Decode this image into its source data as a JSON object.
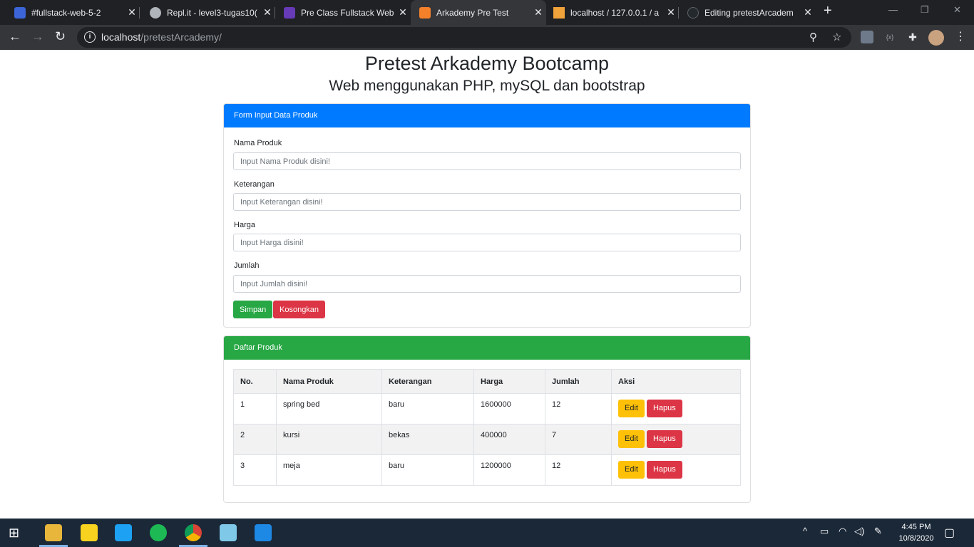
{
  "browser": {
    "tabs": [
      {
        "title": "#fullstack-web-5-2",
        "fav_color": "#3c65d8"
      },
      {
        "title": "Repl.it - level3-tugas10(",
        "fav_color": "#b0b4bb"
      },
      {
        "title": "Pre Class Fullstack Web",
        "fav_color": "#673ab7"
      },
      {
        "title": "Arkademy Pre Test",
        "fav_color": "#f4802a"
      },
      {
        "title": "localhost / 127.0.0.1 / a",
        "fav_color": "#f0a33b"
      },
      {
        "title": "Editing pretestArcadem",
        "fav_color": "#24292e"
      }
    ],
    "url_host": "localhost",
    "url_path": "/pretestArcademy/"
  },
  "page": {
    "title": "Pretest Arkademy Bootcamp",
    "subtitle": "Web menggunakan PHP, mySQL dan bootstrap"
  },
  "form": {
    "header": "Form Input Data Produk",
    "header_color": "#007bff",
    "fields": [
      {
        "label": "Nama Produk",
        "placeholder": "Input Nama Produk disini!"
      },
      {
        "label": "Keterangan",
        "placeholder": "Input Keterangan disini!"
      },
      {
        "label": "Harga",
        "placeholder": "Input Harga disini!"
      },
      {
        "label": "Jumlah",
        "placeholder": "Input Jumlah disini!"
      }
    ],
    "save_label": "Simpan",
    "clear_label": "Kosongkan",
    "save_color": "#28a745",
    "clear_color": "#dc3545"
  },
  "list": {
    "header": "Daftar Produk",
    "header_color": "#28a745",
    "columns": [
      "No.",
      "Nama Produk",
      "Keterangan",
      "Harga",
      "Jumlah",
      "Aksi"
    ],
    "rows": [
      {
        "no": "1",
        "nama": "spring bed",
        "keterangan": "baru",
        "harga": "1600000",
        "jumlah": "12"
      },
      {
        "no": "2",
        "nama": "kursi",
        "keterangan": "bekas",
        "harga": "400000",
        "jumlah": "7"
      },
      {
        "no": "3",
        "nama": "meja",
        "keterangan": "baru",
        "harga": "1200000",
        "jumlah": "12"
      }
    ],
    "edit_label": "Edit",
    "delete_label": "Hapus",
    "edit_color": "#ffc107",
    "delete_color": "#dc3545"
  },
  "taskbar": {
    "time": "4:45 PM",
    "date": "10/8/2020",
    "apps": [
      "file-explorer",
      "sticky-notes",
      "whatsapp",
      "spotify",
      "chrome",
      "notepad",
      "vscode"
    ]
  }
}
